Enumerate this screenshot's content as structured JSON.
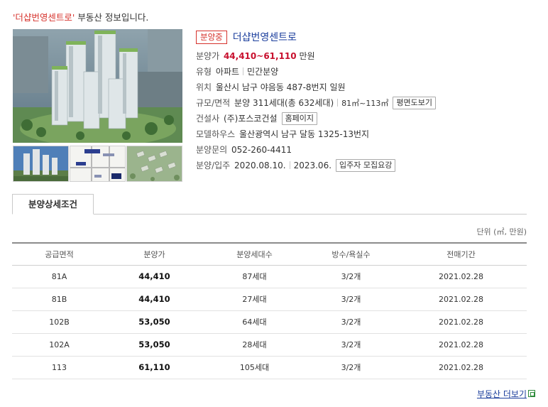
{
  "headline": {
    "name_quoted": "'더샵번영센트로'",
    "rest": " 부동산 정보입니다."
  },
  "property": {
    "status_badge": "분양중",
    "name": "더샵번영센트로",
    "price_label": "분양가",
    "price_value": "44,410~61,110",
    "price_unit": "만원",
    "type_label": "유형",
    "type_value": "아파트",
    "type_value2": "민간분양",
    "location_label": "위치",
    "location_value": "울산시 남구 야음동 487-8번지 일원",
    "scale_label": "규모/면적",
    "scale_value": "분양 311세대(총 632세대)",
    "area_value": "81㎡~113㎡",
    "floorplan_button": "평면도보기",
    "builder_label": "건설사",
    "builder_value": "(주)포스코건설",
    "homepage_button": "홈페이지",
    "modelhouse_label": "모델하우스",
    "modelhouse_value": "울산광역시 남구 달동 1325-13번지",
    "inquiry_label": "분양문의",
    "inquiry_value": "052-260-4411",
    "movein_label": "분양/입주",
    "sale_date": "2020.08.10.",
    "movein_date": "2023.06.",
    "notice_button": "입주자 모집요강"
  },
  "tabs": {
    "active": "분양상세조건"
  },
  "unit_note": "단위 (㎡, 만원)",
  "table": {
    "headers": [
      "공급면적",
      "분양가",
      "분양세대수",
      "방수/욕실수",
      "전매기간"
    ],
    "rows": [
      [
        "81A",
        "44,410",
        "87세대",
        "3/2개",
        "2021.02.28"
      ],
      [
        "81B",
        "44,410",
        "27세대",
        "3/2개",
        "2021.02.28"
      ],
      [
        "102B",
        "53,050",
        "64세대",
        "3/2개",
        "2021.02.28"
      ],
      [
        "102A",
        "53,050",
        "28세대",
        "3/2개",
        "2021.02.28"
      ],
      [
        "113",
        "61,110",
        "105세대",
        "3/2개",
        "2021.02.28"
      ]
    ]
  },
  "more_link": "부동산 더보기",
  "colors": {
    "accent_red": "#d6322c",
    "price_red": "#c8102e",
    "link_blue": "#1a3d9c"
  }
}
